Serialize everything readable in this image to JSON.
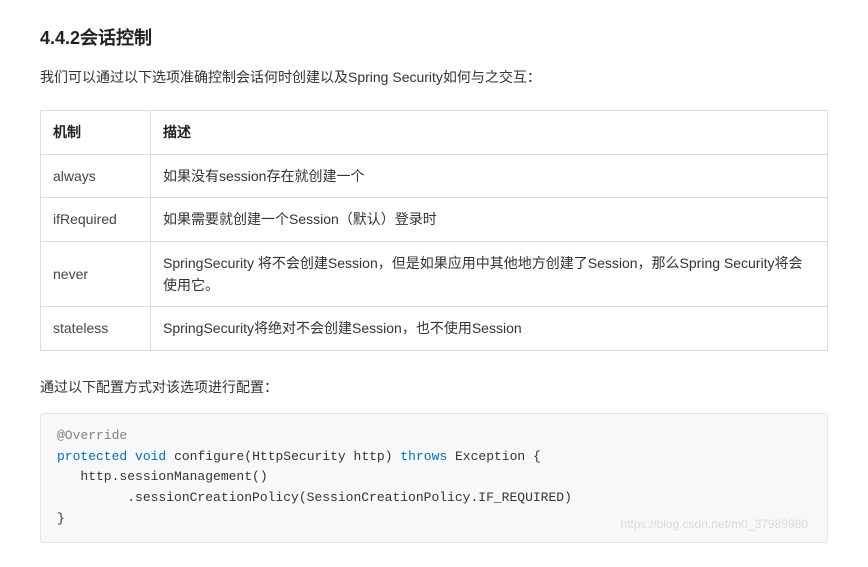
{
  "heading": "4.4.2会话控制",
  "intro": "我们可以通过以下选项准确控制会话何时创建以及Spring Security如何与之交互：",
  "table": {
    "headers": {
      "mechanism": "机制",
      "description": "描述"
    },
    "rows": [
      {
        "mechanism": "always",
        "description": "如果没有session存在就创建一个"
      },
      {
        "mechanism": "ifRequired",
        "description": "如果需要就创建一个Session（默认）登录时"
      },
      {
        "mechanism": "never",
        "description": "SpringSecurity 将不会创建Session，但是如果应用中其他地方创建了Session，那么Spring Security将会使用它。"
      },
      {
        "mechanism": "stateless",
        "description": "SpringSecurity将绝对不会创建Session，也不使用Session"
      }
    ]
  },
  "config_note": "通过以下配置方式对该选项进行配置：",
  "code": {
    "annotation": "@Override",
    "kw_protected": "protected",
    "kw_void": "void",
    "fn_name": "configure",
    "param_type": "HttpSecurity",
    "param_name": "http",
    "kw_throws": "throws",
    "exc_type": "Exception",
    "line2": "   http.sessionManagement()",
    "line3": "         .sessionCreationPolicy(SessionCreationPolicy.IF_REQUIRED)",
    "brace_open": " {",
    "brace_close": "}"
  },
  "watermark": "https://blog.csdn.net/m0_37989980"
}
